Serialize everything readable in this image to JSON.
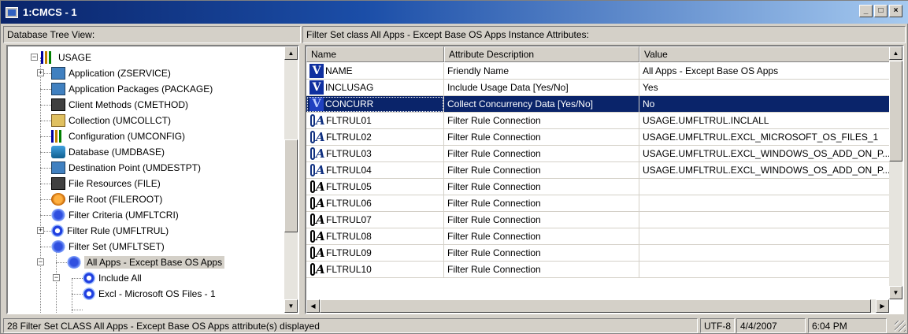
{
  "window": {
    "title": "1:CMCS - 1",
    "buttons": [
      "_",
      "□",
      "×"
    ]
  },
  "tree": {
    "header": "Database Tree View:",
    "items": [
      {
        "label": "USAGE",
        "icon": "usage-bars-icon",
        "expander": "−"
      },
      {
        "label": "Application (ZSERVICE)",
        "icon": "application-icon",
        "expander": "+"
      },
      {
        "label": "Application Packages (PACKAGE)",
        "icon": "package-icon",
        "expander": ""
      },
      {
        "label": "Client Methods (CMETHOD)",
        "icon": "client-methods-icon",
        "expander": ""
      },
      {
        "label": "Collection (UMCOLLCT)",
        "icon": "collection-icon",
        "expander": ""
      },
      {
        "label": "Configuration (UMCONFIG)",
        "icon": "configuration-icon",
        "expander": ""
      },
      {
        "label": "Database (UMDBASE)",
        "icon": "database-icon",
        "expander": ""
      },
      {
        "label": "Destination Point (UMDESTPT)",
        "icon": "destination-icon",
        "expander": ""
      },
      {
        "label": "File Resources (FILE)",
        "icon": "file-resources-icon",
        "expander": ""
      },
      {
        "label": "File Root (FILEROOT)",
        "icon": "file-root-icon",
        "expander": ""
      },
      {
        "label": "Filter Criteria (UMFLTCRI)",
        "icon": "filter-criteria-icon",
        "expander": "+"
      },
      {
        "label": "Filter Rule (UMFLTRUL)",
        "icon": "filter-rule-icon",
        "expander": ""
      },
      {
        "label": "Filter Set (UMFLTSET)",
        "icon": "filter-set-icon",
        "expander": "−"
      },
      {
        "label": "All Apps - Except Base OS Apps",
        "icon": "filter-set-instance-icon",
        "expander": "−"
      },
      {
        "label": "Include All",
        "icon": "filter-rule-icon",
        "expander": ""
      },
      {
        "label": "Excl - Microsoft OS Files - 1",
        "icon": "filter-rule-icon",
        "expander": ""
      }
    ]
  },
  "grid": {
    "header": "Filter Set class All Apps - Except Base OS Apps Instance Attributes:",
    "columns": [
      "Name",
      "Attribute Description",
      "Value"
    ],
    "rows": [
      {
        "badge": "V",
        "name": "NAME",
        "desc": "Friendly Name",
        "value": "All Apps - Except Base OS Apps"
      },
      {
        "badge": "V",
        "name": "INCLUSAG",
        "desc": "Include Usage Data [Yes/No]",
        "value": "Yes"
      },
      {
        "badge": "V",
        "name": "CONCURR",
        "desc": "Collect Concurrency Data [Yes/No]",
        "value": "No"
      },
      {
        "badge": "A",
        "name": "FLTRUL01",
        "desc": "Filter Rule Connection",
        "value": "USAGE.UMFLTRUL.INCLALL"
      },
      {
        "badge": "A",
        "name": "FLTRUL02",
        "desc": "Filter Rule Connection",
        "value": "USAGE.UMFLTRUL.EXCL_MICROSOFT_OS_FILES_1"
      },
      {
        "badge": "A",
        "name": "FLTRUL03",
        "desc": "Filter Rule Connection",
        "value": "USAGE.UMFLTRUL.EXCL_WINDOWS_OS_ADD_ON_P..."
      },
      {
        "badge": "A",
        "name": "FLTRUL04",
        "desc": "Filter Rule Connection",
        "value": "USAGE.UMFLTRUL.EXCL_WINDOWS_OS_ADD_ON_P..."
      },
      {
        "badge": "A",
        "name": "FLTRUL05",
        "desc": "Filter Rule Connection",
        "value": ""
      },
      {
        "badge": "A",
        "name": "FLTRUL06",
        "desc": "Filter Rule Connection",
        "value": ""
      },
      {
        "badge": "A",
        "name": "FLTRUL07",
        "desc": "Filter Rule Connection",
        "value": ""
      },
      {
        "badge": "A",
        "name": "FLTRUL08",
        "desc": "Filter Rule Connection",
        "value": ""
      },
      {
        "badge": "A",
        "name": "FLTRUL09",
        "desc": "Filter Rule Connection",
        "value": ""
      },
      {
        "badge": "A",
        "name": "FLTRUL10",
        "desc": "Filter Rule Connection",
        "value": ""
      }
    ]
  },
  "status": {
    "message": "28 Filter Set CLASS All Apps - Except Base OS Apps attribute(s) displayed",
    "encoding": "UTF-8",
    "date": "4/4/2007",
    "time": "6:04 PM"
  },
  "colors": {
    "titlebar": "#0a246a",
    "selection": "#0a246a",
    "chrome": "#d4d0c8"
  }
}
